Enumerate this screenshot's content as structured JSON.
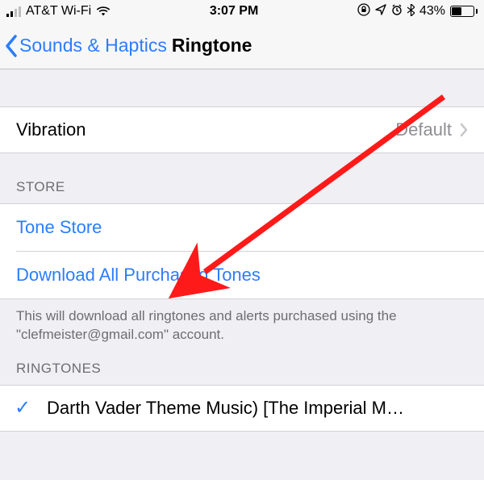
{
  "statusbar": {
    "carrier": "AT&T Wi-Fi",
    "time": "3:07 PM",
    "battery_pct": "43%"
  },
  "nav": {
    "back_label": "Sounds & Haptics",
    "title": "Ringtone"
  },
  "vibration": {
    "label": "Vibration",
    "value": "Default"
  },
  "store": {
    "header": "STORE",
    "tone_store": "Tone Store",
    "download_all": "Download All Purchased Tones",
    "footer": "This will download all ringtones and alerts purchased using the \"clefmeister@gmail.com\" account."
  },
  "ringtones": {
    "header": "RINGTONES",
    "selected": "Darth Vader Theme Music) [The Imperial M…"
  }
}
